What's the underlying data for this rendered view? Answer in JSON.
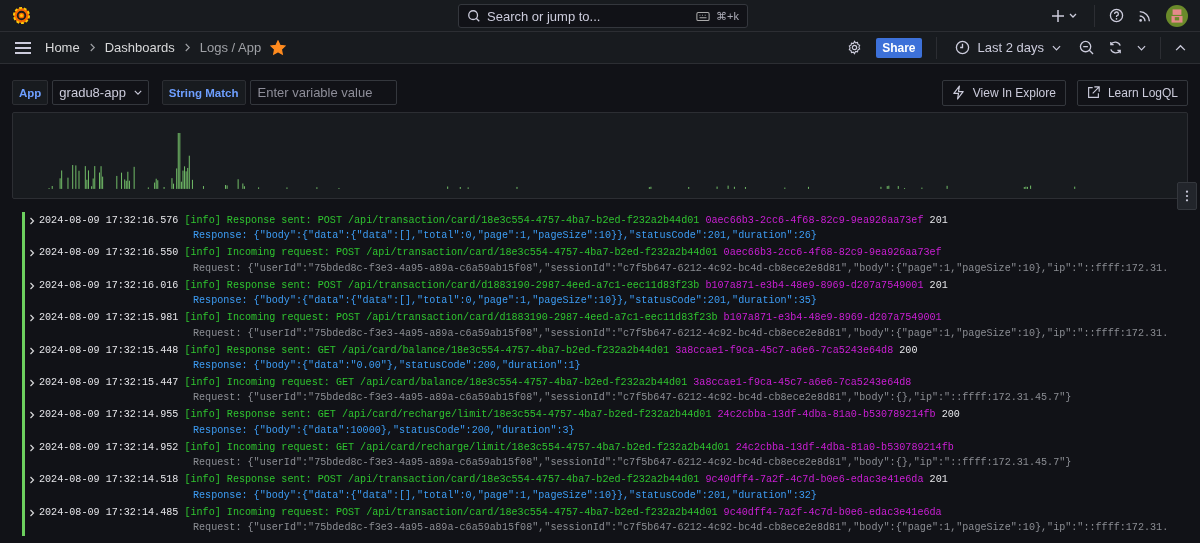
{
  "top_bar": {
    "search": {
      "placeholder": "Search or jump to...",
      "shortcut": "⌘+k"
    }
  },
  "breadcrumbs": [
    {
      "label": "Home",
      "selected": false
    },
    {
      "label": "Dashboards",
      "selected": false
    },
    {
      "label": "Logs / App",
      "selected": true
    }
  ],
  "starred": true,
  "toolbar": {
    "share": "Share",
    "time_range": "Last 2 days"
  },
  "variables": [
    {
      "kind": "select",
      "label": "App",
      "value": "gradu8-app"
    },
    {
      "kind": "text",
      "label": "String Match",
      "placeholder": "Enter variable value"
    }
  ],
  "actions": [
    {
      "kind": "explore",
      "label": "View In Explore"
    },
    {
      "kind": "external",
      "label": "Learn LogQL"
    }
  ],
  "logs": [
    {
      "time": "2024-08-09 17:32:16.576",
      "level": "[info]",
      "message": "Response sent: POST /api/transaction/card/18e3c554-4757-4ba7-b2ed-f232a2b44d01",
      "trace": "0aec66b3-2cc6-4f68-82c9-9ea926aa73ef",
      "status": "201",
      "detail": {
        "kind": "response",
        "text": "Response: {\"body\":{\"data\":{\"data\":[],\"total\":0,\"page\":1,\"pageSize\":10}},\"statusCode\":201,\"duration\":26}"
      }
    },
    {
      "time": "2024-08-09 17:32:16.550",
      "level": "[info]",
      "message": "Incoming request: POST /api/transaction/card/18e3c554-4757-4ba7-b2ed-f232a2b44d01",
      "trace": "0aec66b3-2cc6-4f68-82c9-9ea926aa73ef",
      "detail": {
        "kind": "request",
        "text": "Request: {\"userId\":\"75bded8c-f3e3-4a95-a89a-c6a59ab15f08\",\"sessionId\":\"c7f5b647-6212-4c92-bc4d-cb8ece2e8d81\",\"body\":{\"page\":1,\"pageSize\":10},\"ip\":\"::ffff:172.31."
      }
    },
    {
      "time": "2024-08-09 17:32:16.016",
      "level": "[info]",
      "message": "Response sent: POST /api/transaction/card/d1883190-2987-4eed-a7c1-eec11d83f23b",
      "trace": "b107a871-e3b4-48e9-8969-d207a7549001",
      "status": "201",
      "detail": {
        "kind": "response",
        "text": "Response: {\"body\":{\"data\":{\"data\":[],\"total\":0,\"page\":1,\"pageSize\":10}},\"statusCode\":201,\"duration\":35}"
      }
    },
    {
      "time": "2024-08-09 17:32:15.981",
      "level": "[info]",
      "message": "Incoming request: POST /api/transaction/card/d1883190-2987-4eed-a7c1-eec11d83f23b",
      "trace": "b107a871-e3b4-48e9-8969-d207a7549001",
      "detail": {
        "kind": "request",
        "text": "Request: {\"userId\":\"75bded8c-f3e3-4a95-a89a-c6a59ab15f08\",\"sessionId\":\"c7f5b647-6212-4c92-bc4d-cb8ece2e8d81\",\"body\":{\"page\":1,\"pageSize\":10},\"ip\":\"::ffff:172.31."
      }
    },
    {
      "time": "2024-08-09 17:32:15.448",
      "level": "[info]",
      "message": "Response sent: GET /api/card/balance/18e3c554-4757-4ba7-b2ed-f232a2b44d01",
      "trace": "3a8ccae1-f9ca-45c7-a6e6-7ca5243e64d8",
      "status": "200",
      "detail": {
        "kind": "response",
        "text": "Response: {\"body\":{\"data\":\"0.00\"},\"statusCode\":200,\"duration\":1}"
      }
    },
    {
      "time": "2024-08-09 17:32:15.447",
      "level": "[info]",
      "message": "Incoming request: GET /api/card/balance/18e3c554-4757-4ba7-b2ed-f232a2b44d01",
      "trace": "3a8ccae1-f9ca-45c7-a6e6-7ca5243e64d8",
      "detail": {
        "kind": "request",
        "text": "Request: {\"userId\":\"75bded8c-f3e3-4a95-a89a-c6a59ab15f08\",\"sessionId\":\"c7f5b647-6212-4c92-bc4d-cb8ece2e8d81\",\"body\":{},\"ip\":\"::ffff:172.31.45.7\"}"
      }
    },
    {
      "time": "2024-08-09 17:32:14.955",
      "level": "[info]",
      "message": "Response sent: GET /api/card/recharge/limit/18e3c554-4757-4ba7-b2ed-f232a2b44d01",
      "trace": "24c2cbba-13df-4dba-81a0-b530789214fb",
      "status": "200",
      "detail": {
        "kind": "response",
        "text": "Response: {\"body\":{\"data\":10000},\"statusCode\":200,\"duration\":3}"
      }
    },
    {
      "time": "2024-08-09 17:32:14.952",
      "level": "[info]",
      "message": "Incoming request: GET /api/card/recharge/limit/18e3c554-4757-4ba7-b2ed-f232a2b44d01",
      "trace": "24c2cbba-13df-4dba-81a0-b530789214fb",
      "detail": {
        "kind": "request",
        "text": "Request: {\"userId\":\"75bded8c-f3e3-4a95-a89a-c6a59ab15f08\",\"sessionId\":\"c7f5b647-6212-4c92-bc4d-cb8ece2e8d81\",\"body\":{},\"ip\":\"::ffff:172.31.45.7\"}"
      }
    },
    {
      "time": "2024-08-09 17:32:14.518",
      "level": "[info]",
      "message": "Response sent: POST /api/transaction/card/18e3c554-4757-4ba7-b2ed-f232a2b44d01",
      "trace": "9c40dff4-7a2f-4c7d-b0e6-edac3e41e6da",
      "status": "201",
      "detail": {
        "kind": "response",
        "text": "Response: {\"body\":{\"data\":{\"data\":[],\"total\":0,\"page\":1,\"pageSize\":10}},\"statusCode\":201,\"duration\":32}"
      }
    },
    {
      "time": "2024-08-09 17:32:14.485",
      "level": "[info]",
      "message": "Incoming request: POST /api/transaction/card/18e3c554-4757-4ba7-b2ed-f232a2b44d01",
      "trace": "9c40dff4-7a2f-4c7d-b0e6-edac3e41e6da",
      "detail": {
        "kind": "request",
        "text": "Request: {\"userId\":\"75bded8c-f3e3-4a95-a89a-c6a59ab15f08\",\"sessionId\":\"c7f5b647-6212-4c92-bc4d-cb8ece2e8d81\",\"body\":{\"page\":1,\"pageSize\":10},\"ip\":\"::ffff:172.31."
      }
    }
  ]
}
